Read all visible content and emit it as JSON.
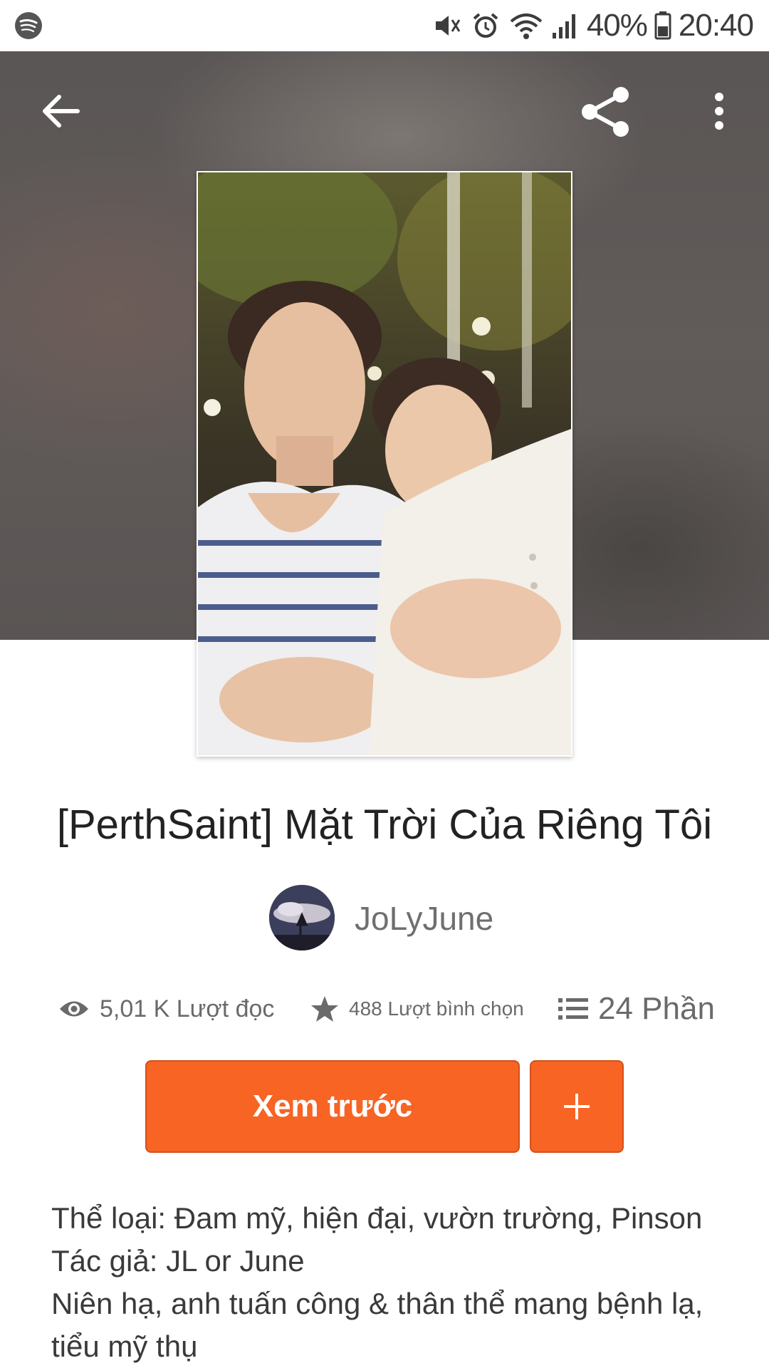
{
  "status_bar": {
    "battery": "40%",
    "time": "20:40",
    "icons": [
      "spotify-icon",
      "mute-icon",
      "alarm-icon",
      "wifi-icon",
      "signal-icon",
      "battery-icon"
    ]
  },
  "header": {
    "back_icon": "arrow-left-icon",
    "share_icon": "share-icon",
    "more_icon": "more-vertical-icon"
  },
  "story": {
    "title": "[PerthSaint] Mặt Trời Của Riêng Tôi",
    "author": "JoLyJune",
    "stats": {
      "reads": "5,01 K Lượt đọc",
      "votes": "488 Lượt bình chọn",
      "parts": "24 Phần"
    },
    "preview_button": "Xem trước",
    "add_button": "+",
    "description": [
      "Thể loại: Đam mỹ, hiện đại, vườn trường, Pinson",
      "Tác giả: JL or June",
      "Niên hạ, anh tuấn công & thân thể mang bệnh lạ,",
      "tiểu mỹ thụ"
    ]
  },
  "colors": {
    "accent": "#f76424",
    "header_bg": "#5a5655"
  }
}
